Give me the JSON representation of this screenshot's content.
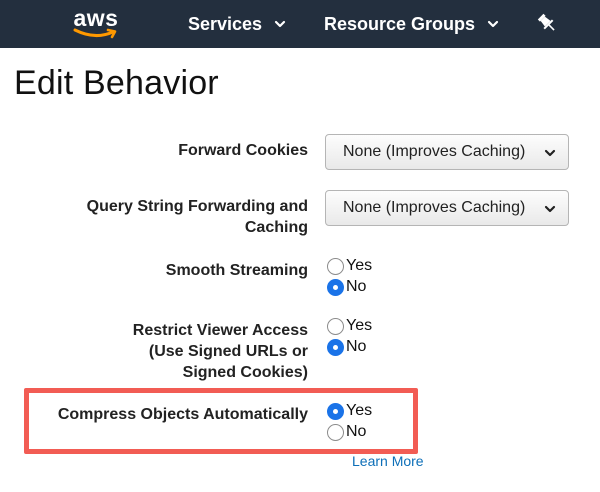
{
  "nav": {
    "logo_text": "aws",
    "services_label": "Services",
    "resource_groups_label": "Resource Groups",
    "pin_icon": "pin-icon"
  },
  "page": {
    "title": "Edit Behavior"
  },
  "form": {
    "forward_cookies": {
      "label": "Forward Cookies",
      "value": "None (Improves Caching)"
    },
    "query_string": {
      "label_line1": "Query String Forwarding and",
      "label_line2": "Caching",
      "value": "None (Improves Caching)"
    },
    "smooth_streaming": {
      "label": "Smooth Streaming",
      "yes": "Yes",
      "no": "No",
      "selected": "No"
    },
    "restrict_viewer": {
      "label_line1": "Restrict Viewer Access",
      "label_line2": "(Use Signed URLs or",
      "label_line3": "Signed Cookies)",
      "yes": "Yes",
      "no": "No",
      "selected": "No"
    },
    "compress": {
      "label": "Compress Objects Automatically",
      "yes": "Yes",
      "no": "No",
      "selected": "Yes",
      "learn_more": "Learn More"
    }
  },
  "colors": {
    "nav_bg": "#232f3e",
    "logo_smile": "#ff9900",
    "radio_checked": "#1a73e8",
    "highlight": "#f25c54",
    "link": "#0d6fb8"
  }
}
